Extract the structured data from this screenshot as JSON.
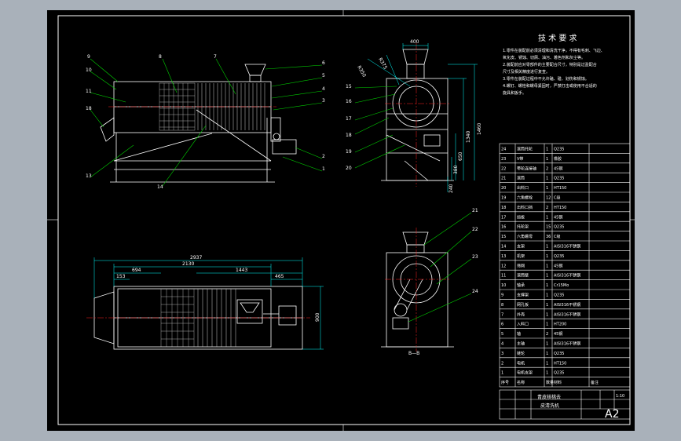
{
  "colors": {
    "background": "#a9b1ba",
    "sheet": "#000000",
    "line": "#ffffff",
    "callout": "#00d000",
    "dimension": "#00ffff",
    "center": "#ff2020",
    "accent": "#ffff00",
    "mesh": "#ff60ff"
  },
  "front_view_callouts": [
    "9",
    "10",
    "11",
    "18",
    "13",
    "8",
    "14",
    "7",
    "6",
    "5",
    "4",
    "3",
    "2",
    "1"
  ],
  "side_view_callouts": [
    "15",
    "16",
    "17",
    "18",
    "19",
    "20"
  ],
  "side_view_dims": {
    "top_width": "400",
    "radius_1": "R350",
    "radius_2": "R375",
    "h1": "1460",
    "h2": "1340",
    "h3": "650",
    "h4": "380",
    "h5": "240"
  },
  "end_view_callouts": [
    "21",
    "22",
    "23",
    "24"
  ],
  "end_view_caption": "B—B",
  "plan_dims": {
    "overall": "2937",
    "d1": "2130",
    "d2": "694",
    "d3": "1443",
    "d4": "153",
    "d5": "465",
    "height": "900"
  },
  "tech_req": {
    "heading": "技 术 要 求",
    "lines": [
      "1.零件在装配前必须清理和清洗干净，不得有毛刺、飞边、",
      "   氧化皮、锈蚀、切屑、油污、着色剂和灰尘等。",
      "2.装配前应对零部件的主要配合尺寸，特别是过盈配合",
      "   尺寸及相关精度进行复查。",
      "3.零件在装配过程中不允许磕、碰、划伤和锈蚀。",
      "4.螺钉、螺栓和螺母紧固时，严禁打击或使用不合适的",
      "   旋具和扳手。"
    ]
  },
  "bom": [
    {
      "no": "24",
      "name": "滚筒托轮",
      "qty": "1",
      "mat": "Q235",
      "note": ""
    },
    {
      "no": "23",
      "name": "V带",
      "qty": "1",
      "mat": "橡胶",
      "note": ""
    },
    {
      "no": "22",
      "name": "带轮连接轴",
      "qty": "2",
      "mat": "45钢",
      "note": ""
    },
    {
      "no": "21",
      "name": "滚筒",
      "qty": "1",
      "mat": "Q235",
      "note": ""
    },
    {
      "no": "20",
      "name": "出料口",
      "qty": "1",
      "mat": "HT150",
      "note": ""
    },
    {
      "no": "19",
      "name": "六角螺栓",
      "qty": "12",
      "mat": "C级",
      "note": ""
    },
    {
      "no": "18",
      "name": "出料口挡",
      "qty": "2",
      "mat": "HT150",
      "note": ""
    },
    {
      "no": "17",
      "name": "挡板",
      "qty": "1",
      "mat": "45钢",
      "note": ""
    },
    {
      "no": "16",
      "name": "托轮架",
      "qty": "15",
      "mat": "Q235",
      "note": ""
    },
    {
      "no": "15",
      "name": "六角螺母",
      "qty": "36",
      "mat": "C级",
      "note": ""
    },
    {
      "no": "14",
      "name": "支架",
      "qty": "1",
      "mat": "AISI316不锈钢",
      "note": ""
    },
    {
      "no": "13",
      "name": "机架",
      "qty": "1",
      "mat": "Q235",
      "note": ""
    },
    {
      "no": "12",
      "name": "筛网",
      "qty": "1",
      "mat": "45钢",
      "note": ""
    },
    {
      "no": "11",
      "name": "滚筒壁",
      "qty": "1",
      "mat": "AISI316不锈钢",
      "note": ""
    },
    {
      "no": "10",
      "name": "轴承",
      "qty": "1",
      "mat": "Cr15Mo",
      "note": ""
    },
    {
      "no": "9",
      "name": "支撑架",
      "qty": "1",
      "mat": "Q235",
      "note": ""
    },
    {
      "no": "8",
      "name": "网孔板",
      "qty": "1",
      "mat": "AISI316不锈钢",
      "note": ""
    },
    {
      "no": "7",
      "name": "外壳",
      "qty": "1",
      "mat": "AISI316不锈钢",
      "note": ""
    },
    {
      "no": "6",
      "name": "入料口",
      "qty": "1",
      "mat": "HT200",
      "note": ""
    },
    {
      "no": "5",
      "name": "轴",
      "qty": "2",
      "mat": "45钢",
      "note": ""
    },
    {
      "no": "4",
      "name": "主轴",
      "qty": "1",
      "mat": "AISI316不锈钢",
      "note": ""
    },
    {
      "no": "3",
      "name": "链轮",
      "qty": "1",
      "mat": "Q235",
      "note": ""
    },
    {
      "no": "2",
      "name": "电机",
      "qty": "1",
      "mat": "HT150",
      "note": ""
    },
    {
      "no": "1",
      "name": "电机支架",
      "qty": "1",
      "mat": "Q235",
      "note": ""
    }
  ],
  "bom_header": {
    "no": "序号",
    "name": "名称",
    "qty": "数量",
    "mat": "材料",
    "note": "备注"
  },
  "title_block": {
    "title_line1": "青皮核桃去",
    "title_line2": "皮清洗机",
    "sheet_size": "A2",
    "scale": "1:10"
  }
}
